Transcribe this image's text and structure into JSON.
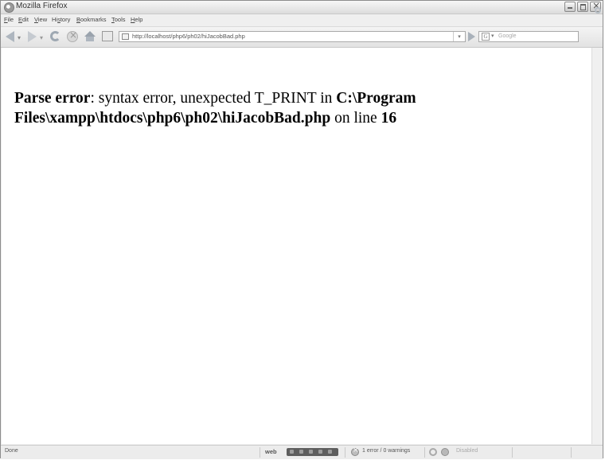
{
  "window": {
    "title": "Mozilla Firefox"
  },
  "menu": {
    "items": [
      {
        "label_u": "F",
        "label_rest": "ile"
      },
      {
        "label_u": "E",
        "label_rest": "dit"
      },
      {
        "label_u": "V",
        "label_rest": "iew"
      },
      {
        "label_pre": "Hi",
        "label_u": "s",
        "label_rest": "tory"
      },
      {
        "label_u": "B",
        "label_rest": "ookmarks"
      },
      {
        "label_u": "T",
        "label_rest": "ools"
      },
      {
        "label_u": "H",
        "label_rest": "elp"
      }
    ]
  },
  "navbar": {
    "url": "http://localhost/php6/ph02/hiJacobBad.php",
    "search_engine": "G",
    "search_placeholder": "Google"
  },
  "content": {
    "error_label": "Parse error",
    "error_message": ": syntax error, unexpected T_PRINT in ",
    "error_path": "C:\\Program Files\\xampp\\htdocs\\php6\\ph02\\hiJacobBad.php",
    "line_text": " on line ",
    "line_number": "16"
  },
  "statusbar": {
    "status": "Done",
    "webdev_logo": "web",
    "errors_summary": "1 error / 0 warnings",
    "disabled_label": "Disabled"
  }
}
